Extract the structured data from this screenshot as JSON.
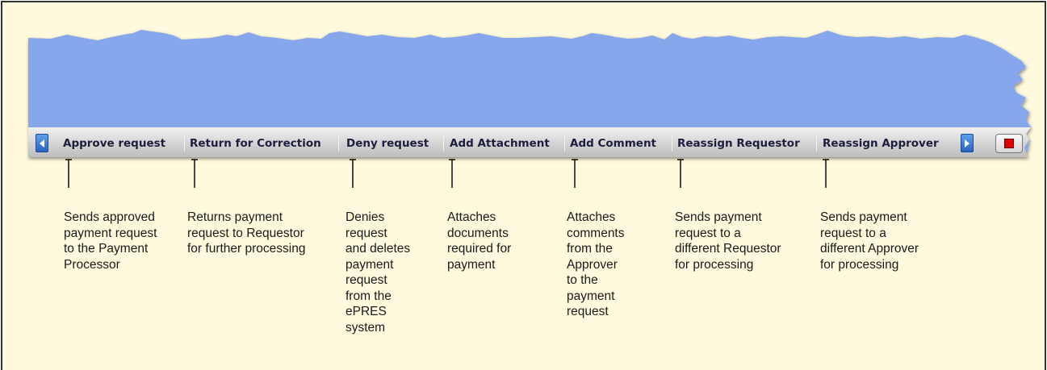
{
  "toolbar": {
    "scroll_left_icon": "triangle-left-icon",
    "scroll_right_icon": "triangle-right-icon",
    "stop_icon": "red-square-icon",
    "buttons": [
      {
        "label": "Approve request"
      },
      {
        "label": "Return for Correction"
      },
      {
        "label": "Deny request"
      },
      {
        "label": "Add Attachment"
      },
      {
        "label": "Add Comment"
      },
      {
        "label": "Reassign Requestor"
      },
      {
        "label": "Reassign Approver"
      }
    ]
  },
  "descriptions": [
    [
      "Sends approved",
      "payment request",
      "to the Payment",
      "Processor"
    ],
    [
      "Returns payment",
      "request to Requestor",
      "for further processing"
    ],
    [
      "Denies",
      "request",
      "and deletes",
      "payment",
      "request",
      "from the",
      "ePRES",
      "system"
    ],
    [
      "Attaches",
      "documents",
      "required for",
      "payment"
    ],
    [
      "Attaches",
      "comments",
      "from the",
      "Approver",
      "to the",
      "payment",
      "request"
    ],
    [
      "Sends payment",
      "request to a",
      "different Requestor",
      "for processing"
    ],
    [
      "Sends payment",
      "request to a",
      "different Approver",
      "for processing"
    ]
  ],
  "colors": {
    "background": "#fff9dd",
    "banner": "#86a7ec",
    "toolbar": "#d2d2d2",
    "scroll_button": "#3c7bd6",
    "stop": "#e00000"
  }
}
